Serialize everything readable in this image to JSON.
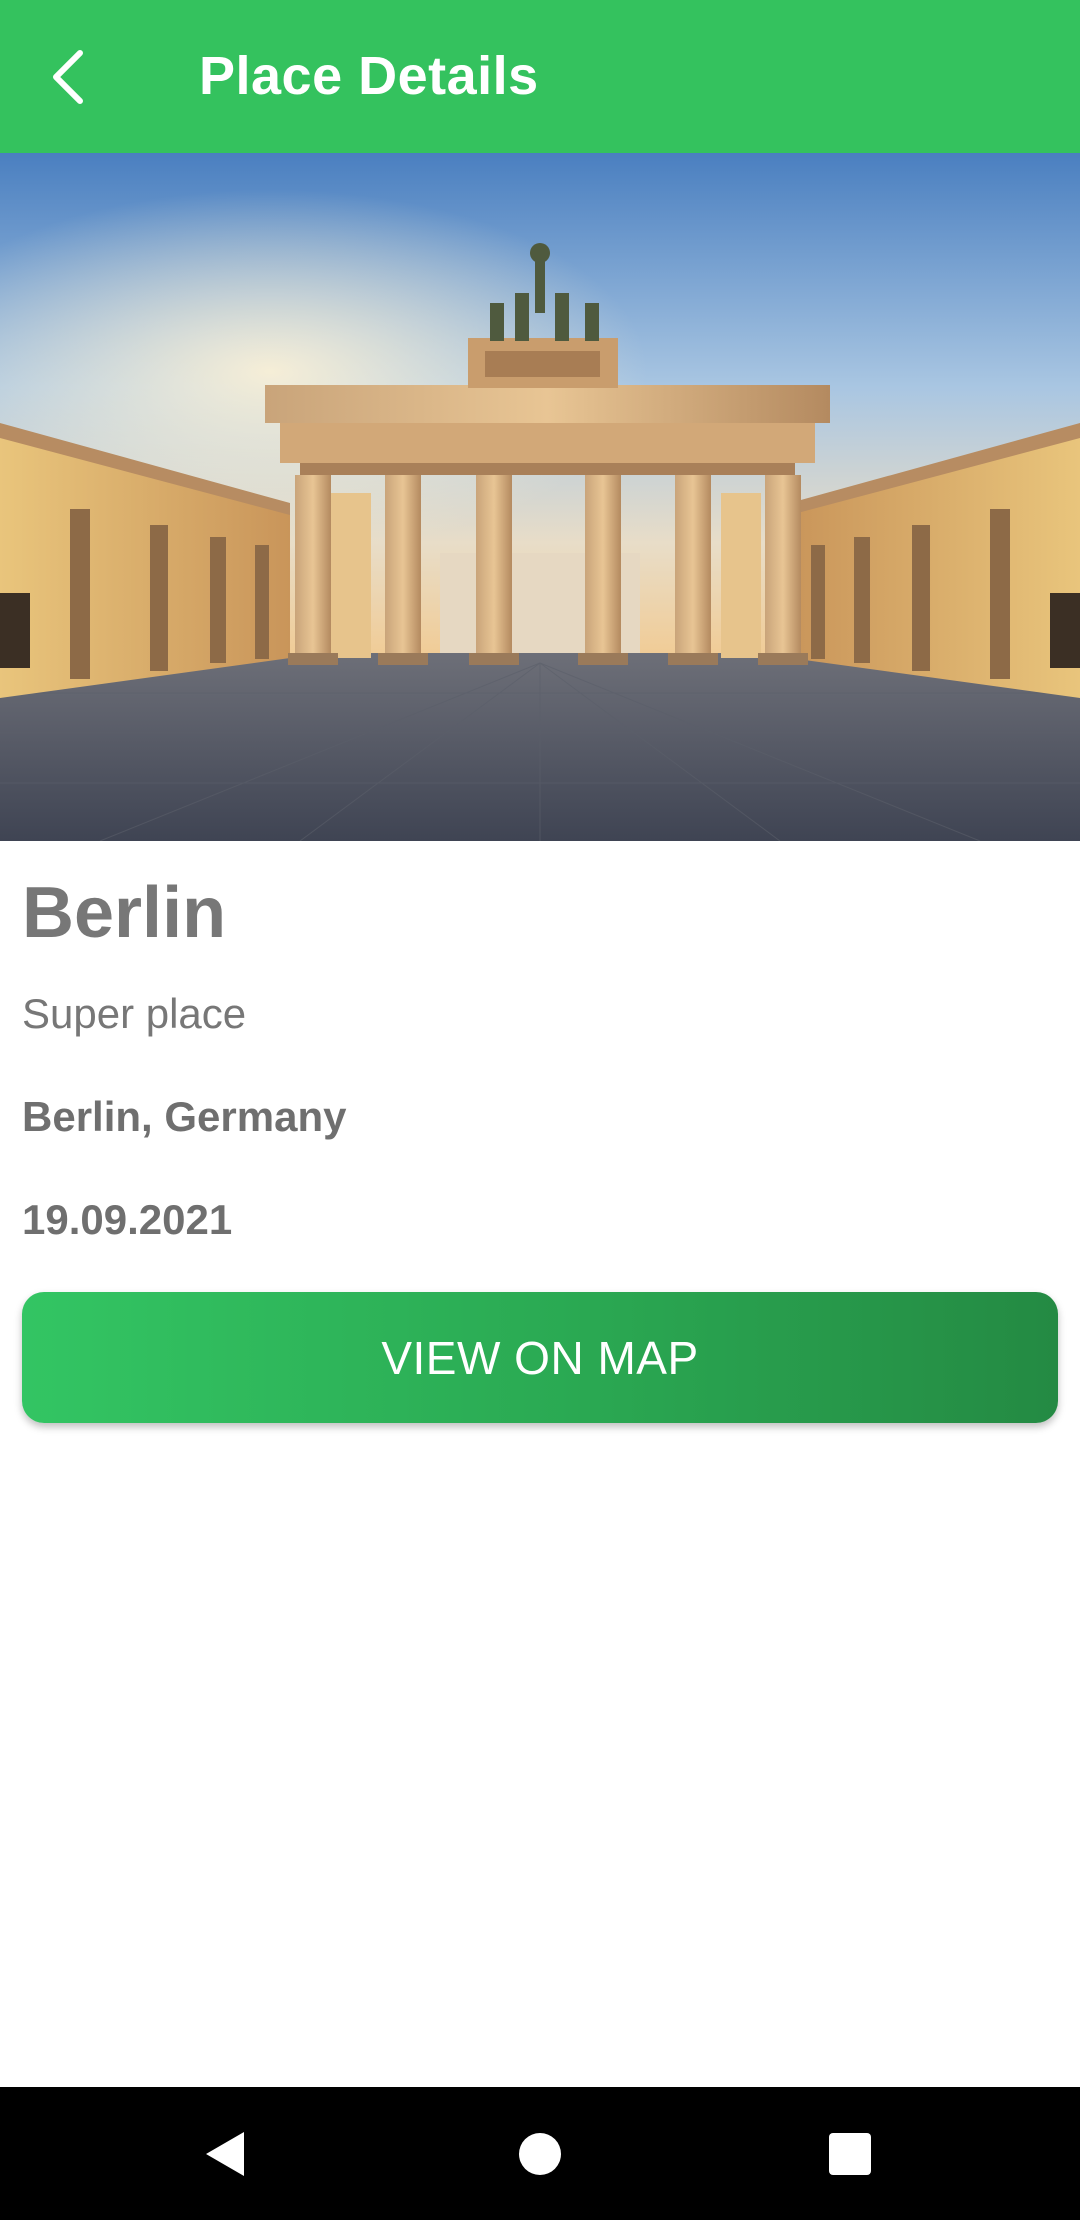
{
  "appbar": {
    "title": "Place Details",
    "back_icon": "arrow-back-icon",
    "color": "#34c25e"
  },
  "hero": {
    "subject": "brandenburg-gate-photo"
  },
  "place": {
    "name": "Berlin",
    "description": "Super place",
    "location": "Berlin, Germany",
    "date": "19.09.2021"
  },
  "actions": {
    "view_on_map_label": "VIEW ON MAP"
  },
  "system_nav": {
    "back_icon": "nav-back-icon",
    "home_icon": "nav-home-icon",
    "recents_icon": "nav-recents-icon"
  },
  "colors": {
    "accent": "#34c25e",
    "button_gradient_start": "#33c563",
    "button_gradient_end": "#248a43",
    "text_gray": "#777777"
  }
}
